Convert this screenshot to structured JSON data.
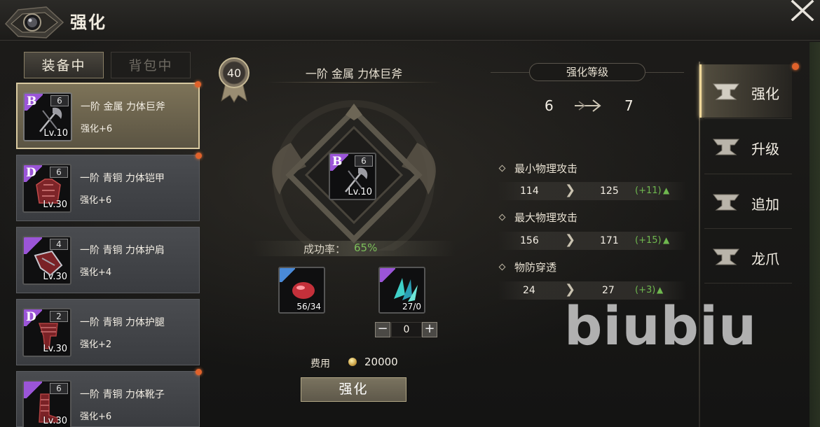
{
  "title": "强化",
  "tabs": [
    {
      "label": "装备中",
      "active": true
    },
    {
      "label": "背包中",
      "active": false
    }
  ],
  "items": [
    {
      "grade": "B",
      "grade_color": "purple",
      "count": "6",
      "level": "Lv.10",
      "name": "一阶 金属 力体巨斧",
      "enhance": "强化+6",
      "selected": true,
      "dot": true
    },
    {
      "grade": "D",
      "grade_color": "purple",
      "count": "6",
      "level": "Lv.30",
      "name": "一阶 青铜 力体铠甲",
      "enhance": "强化+6",
      "selected": false,
      "dot": true
    },
    {
      "grade": "",
      "grade_color": "purple",
      "count": "4",
      "level": "Lv.30",
      "name": "一阶 青铜 力体护肩",
      "enhance": "强化+4",
      "selected": false,
      "dot": false
    },
    {
      "grade": "D",
      "grade_color": "purple",
      "count": "2",
      "level": "Lv.30",
      "name": "一阶 青铜 力体护腿",
      "enhance": "强化+2",
      "selected": false,
      "dot": false
    },
    {
      "grade": "",
      "grade_color": "purple",
      "count": "6",
      "level": "Lv.30",
      "name": "一阶 青铜 力体靴子",
      "enhance": "强化+6",
      "selected": false,
      "dot": true
    }
  ],
  "center": {
    "badge_level": "40",
    "item_title": "一阶 金属 力体巨斧",
    "item_grade": "B",
    "item_count": "6",
    "item_level": "Lv.10",
    "success_label": "成功率：",
    "success_value": "65%",
    "materials": [
      {
        "name": "red-gem",
        "count": "56/34",
        "grade_color": "blue"
      },
      {
        "name": "blue-crystal",
        "count": "27/0",
        "grade_color": "purple"
      }
    ],
    "stepper_value": "0",
    "cost_label": "费用",
    "cost_value": "20000",
    "button_label": "强化"
  },
  "stats": {
    "header": "强化等级",
    "level_from": "6",
    "level_to": "7",
    "rows": [
      {
        "name": "最小物理攻击",
        "current": "114",
        "next": "125",
        "delta": "(+11)"
      },
      {
        "name": "最大物理攻击",
        "current": "156",
        "next": "171",
        "delta": "(+15)"
      },
      {
        "name": "物防穿透",
        "current": "24",
        "next": "27",
        "delta": "(+3)"
      }
    ]
  },
  "nav": [
    {
      "label": "强化",
      "active": true
    },
    {
      "label": "升级",
      "active": false
    },
    {
      "label": "追加",
      "active": false
    },
    {
      "label": "龙爪",
      "active": false
    }
  ],
  "watermark": "biubiu",
  "colors": {
    "success": "#7cbf5a",
    "delta": "#6fb84f",
    "notify_dot": "#e0622b",
    "selected_border": "#d8c9a0"
  }
}
